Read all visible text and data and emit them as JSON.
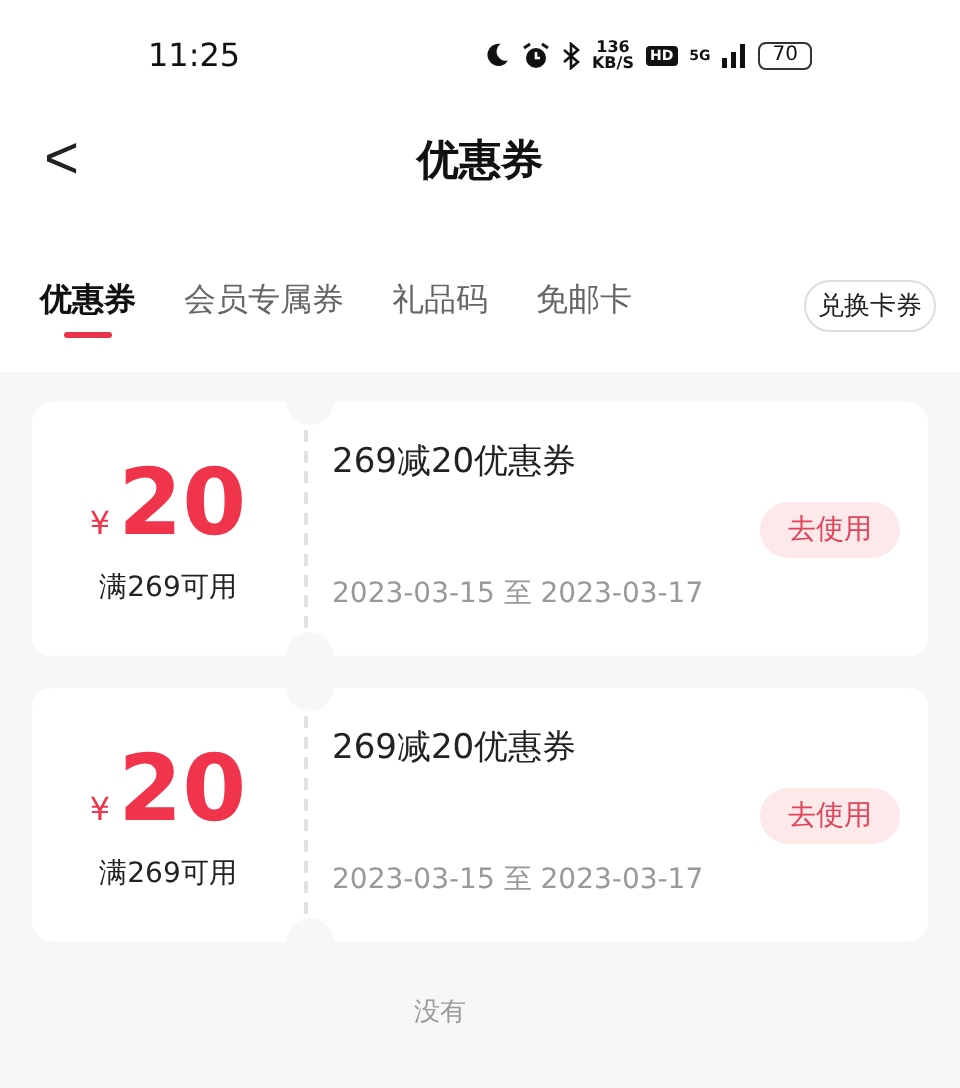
{
  "status_bar": {
    "time": "11:25",
    "net_speed": "136",
    "net_unit": "KB/S",
    "hd": "HD",
    "network": "5G",
    "battery": "70"
  },
  "header": {
    "back": "<",
    "title": "优惠券"
  },
  "tabs": [
    {
      "label": "优惠券",
      "selected": true
    },
    {
      "label": "会员专属券",
      "selected": false
    },
    {
      "label": "礼品码",
      "selected": false
    },
    {
      "label": "免邮卡",
      "selected": false
    }
  ],
  "redeem_button": "兑换卡券",
  "coupons": [
    {
      "currency": "¥",
      "amount": "20",
      "condition": "满269可用",
      "title": "269减20优惠券",
      "validity": "2023-03-15 至 2023-03-17",
      "action": "去使用"
    },
    {
      "currency": "¥",
      "amount": "20",
      "condition": "满269可用",
      "title": "269减20优惠券",
      "validity": "2023-03-15 至 2023-03-17",
      "action": "去使用"
    }
  ],
  "footer": "没有"
}
